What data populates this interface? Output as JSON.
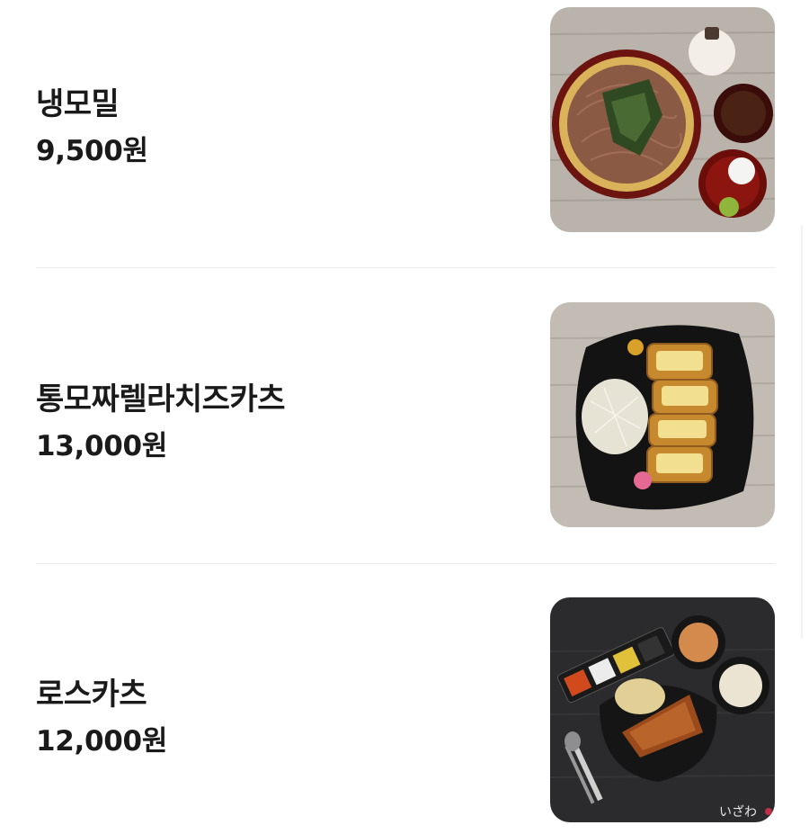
{
  "menu": {
    "items": [
      {
        "name": "냉모밀",
        "price": "9,500원",
        "image": "cold-soba-photo"
      },
      {
        "name": "통모짜렐라치즈카츠",
        "price": "13,000원",
        "image": "cheese-katsu-photo"
      },
      {
        "name": "로스카츠",
        "price": "12,000원",
        "image": "rosu-katsu-photo",
        "image_watermark": "いざわ"
      }
    ]
  }
}
